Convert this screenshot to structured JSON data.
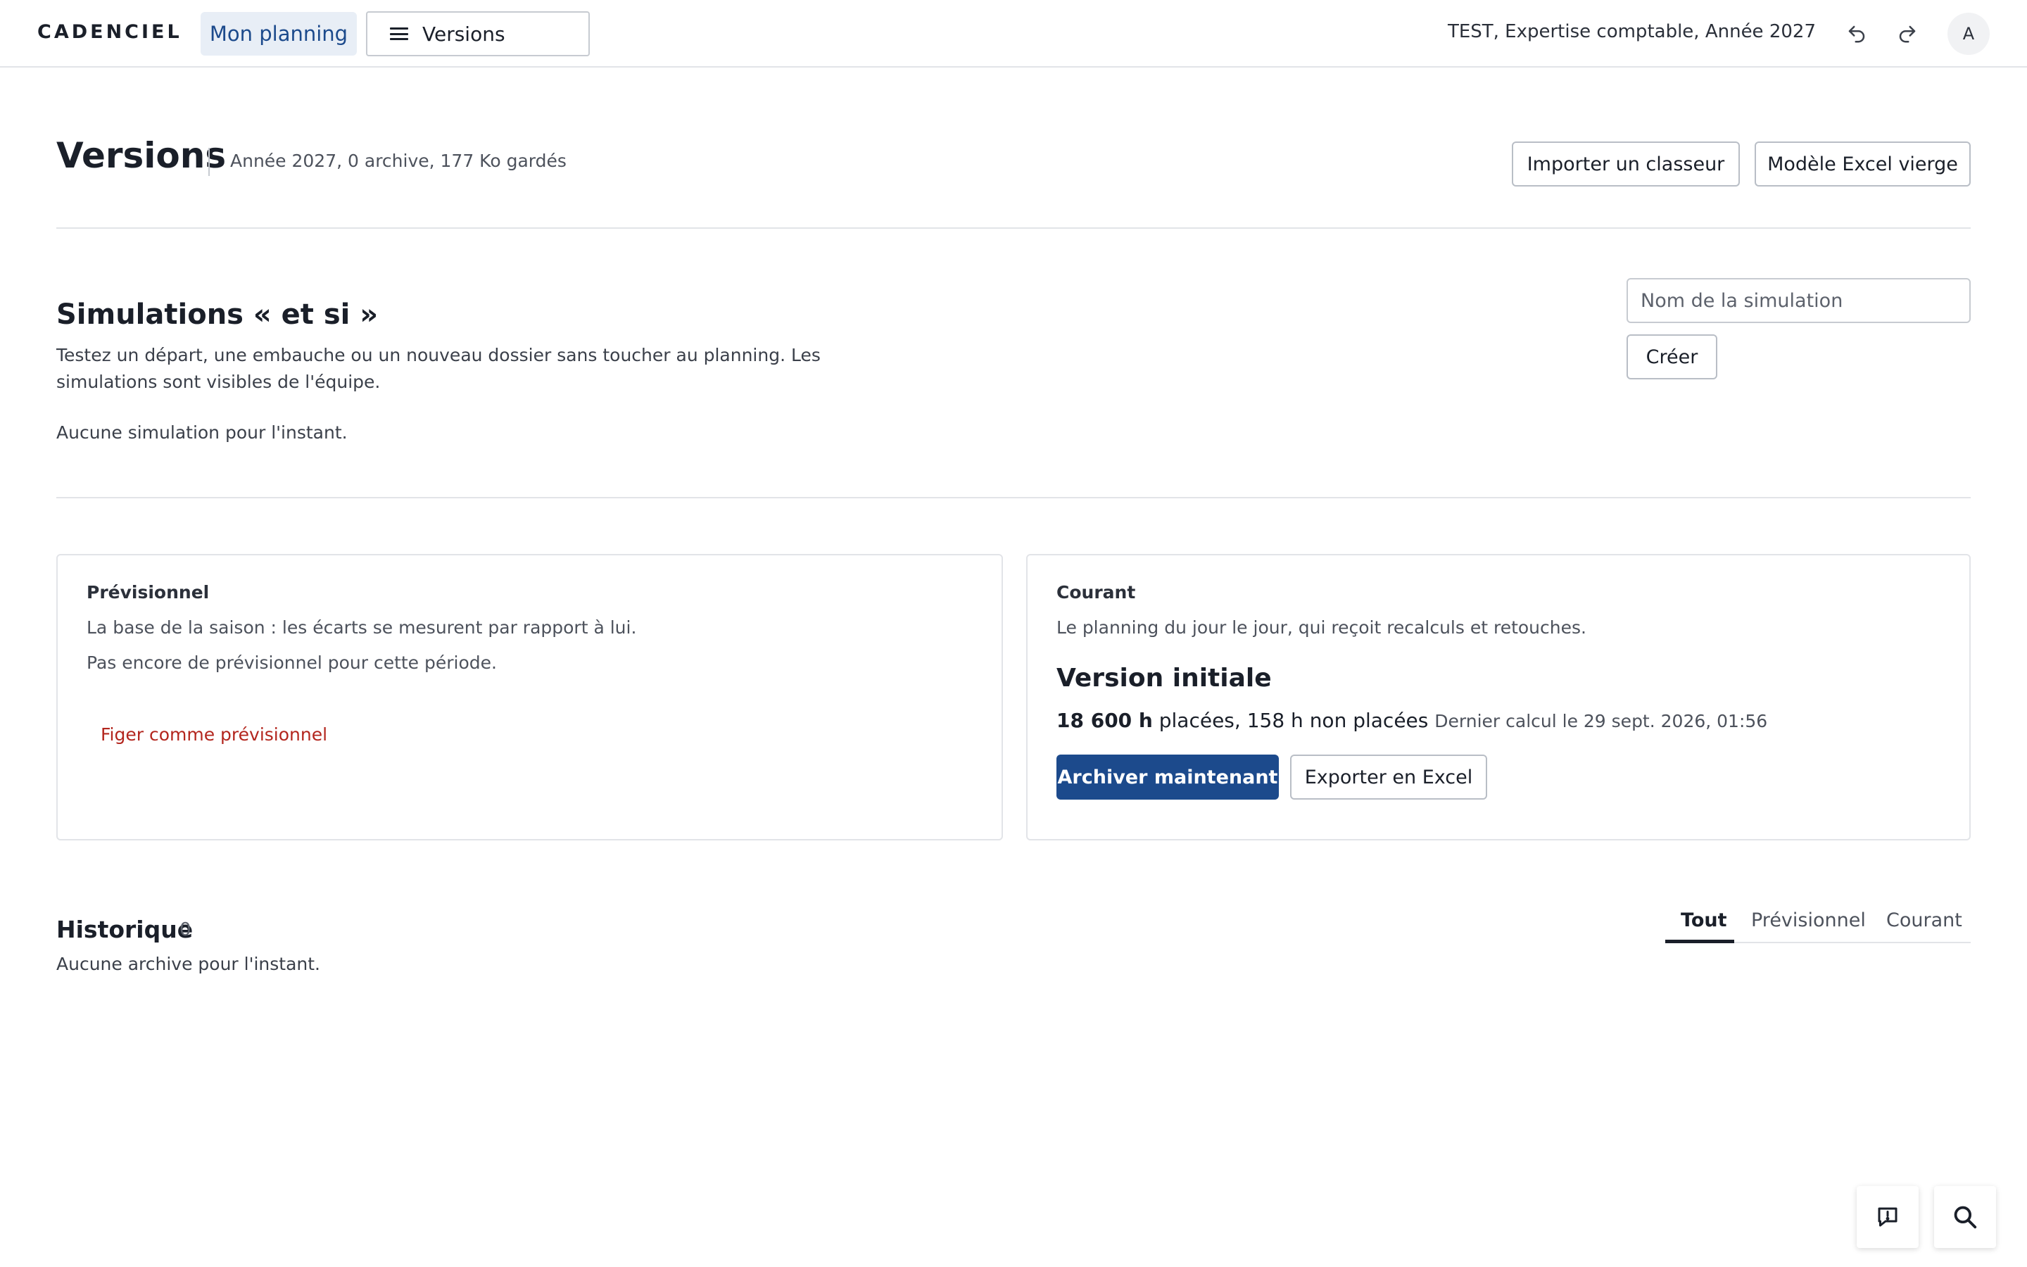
{
  "header": {
    "brand": "CADENCIEL",
    "nav_active": "Mon planning",
    "nav_versions": "Versions",
    "context": "TEST, Expertise comptable, Année 2027",
    "avatar_initial": "A",
    "icons": [
      "undo-icon",
      "redo-icon",
      "menu-icon"
    ]
  },
  "page": {
    "title": "Versions",
    "meta": "Année 2027, 0 archive, 177 Ko gardés",
    "import_label": "Importer un classeur",
    "template_label": "Modèle Excel vierge"
  },
  "simulations": {
    "title": "Simulations « et si »",
    "description": "Testez un départ, une embauche ou un nouveau dossier sans toucher au planning. Les simulations sont visibles de l'équipe.",
    "empty": "Aucune simulation pour l'instant.",
    "input_placeholder": "Nom de la simulation",
    "create_label": "Créer"
  },
  "forecast": {
    "label": "Prévisionnel",
    "description": "La base de la saison : les écarts se mesurent par rapport à lui.",
    "empty": "Pas encore de prévisionnel pour cette période.",
    "freeze_label": "Figer comme prévisionnel"
  },
  "current": {
    "label": "Courant",
    "description": "Le planning du jour le jour, qui reçoit recalculs et retouches.",
    "version_title": "Version initiale",
    "hours_placed": "18 600 h",
    "hours_rest": "placées, 158 h non placées",
    "last_calc": "Dernier calcul le 29 sept. 2026, 01:56",
    "archive_label": "Archiver maintenant",
    "export_label": "Exporter en Excel",
    "accent_color": "#1c4a8c"
  },
  "history": {
    "title": "Historique",
    "count": "0",
    "empty": "Aucune archive pour l'instant.",
    "tabs": [
      "Tout",
      "Prévisionnel",
      "Courant"
    ],
    "active_tab": "Tout"
  },
  "floating": {
    "icons": [
      "feedback-icon",
      "search-icon"
    ]
  }
}
